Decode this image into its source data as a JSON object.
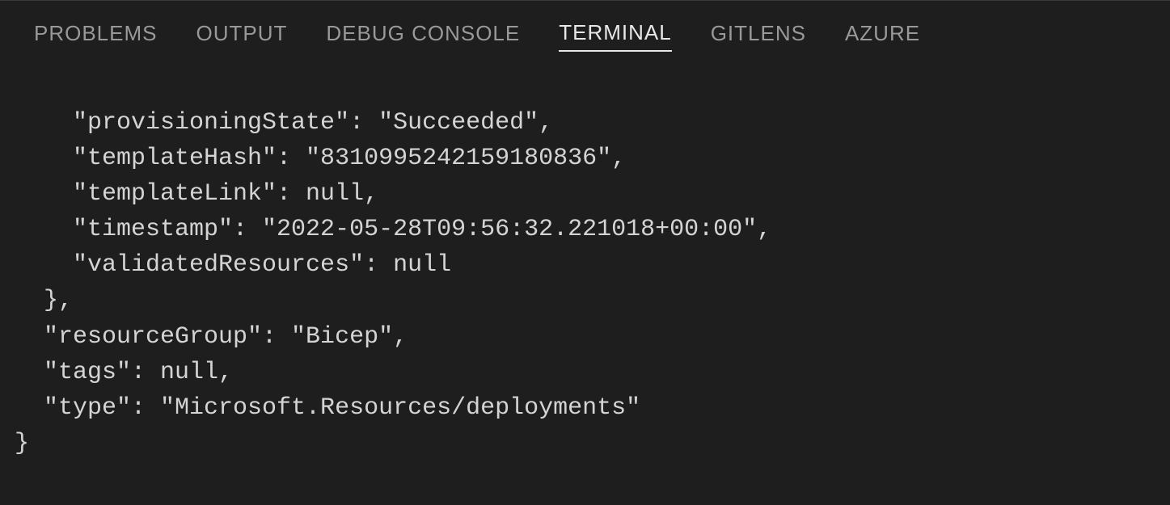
{
  "tabs": [
    {
      "label": "PROBLEMS",
      "active": false
    },
    {
      "label": "OUTPUT",
      "active": false
    },
    {
      "label": "DEBUG CONSOLE",
      "active": false
    },
    {
      "label": "TERMINAL",
      "active": true
    },
    {
      "label": "GITLENS",
      "active": false
    },
    {
      "label": "AZURE",
      "active": false
    }
  ],
  "terminal": {
    "lines": [
      "    \"provisioningState\": \"Succeeded\",",
      "    \"templateHash\": \"8310995242159180836\",",
      "    \"templateLink\": null,",
      "    \"timestamp\": \"2022-05-28T09:56:32.221018+00:00\",",
      "    \"validatedResources\": null",
      "  },",
      "  \"resourceGroup\": \"Bicep\",",
      "  \"tags\": null,",
      "  \"type\": \"Microsoft.Resources/deployments\"",
      "}"
    ]
  }
}
